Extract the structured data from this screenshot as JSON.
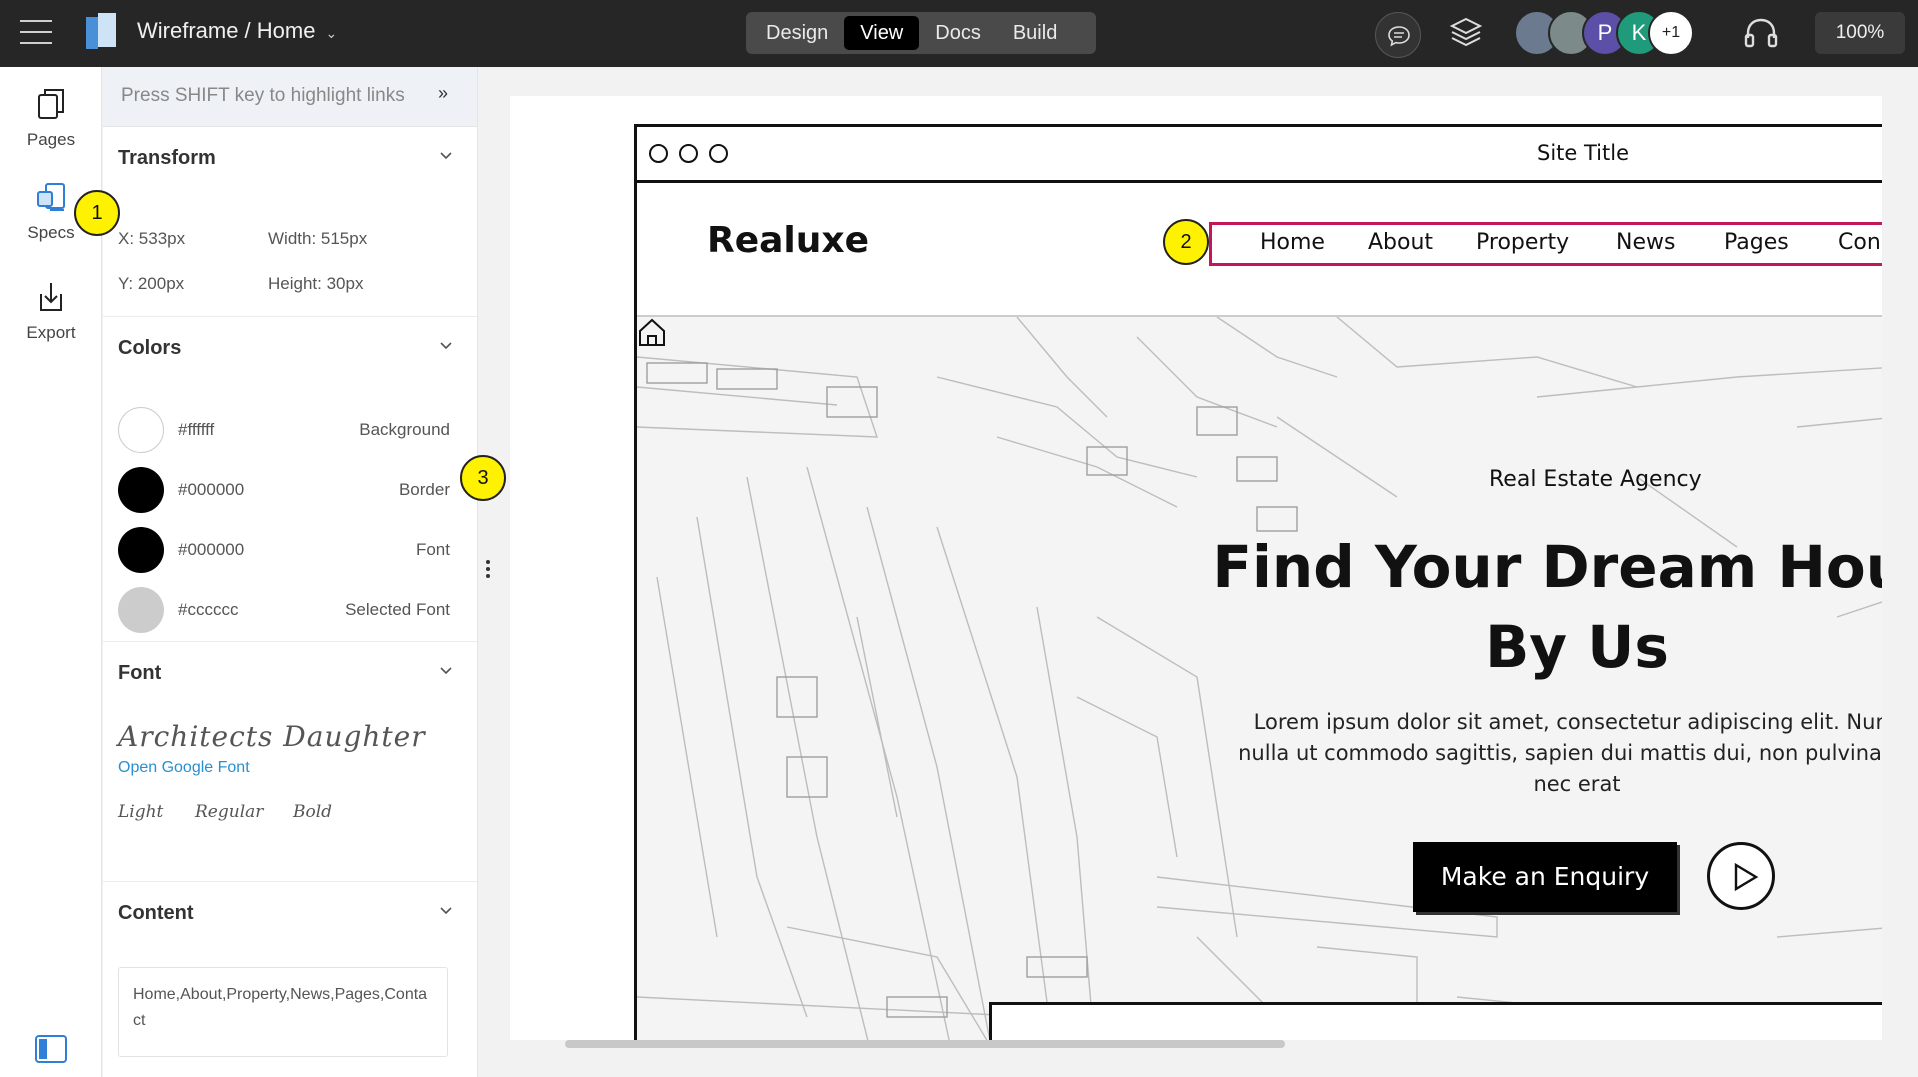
{
  "topbar": {
    "doc_title": "Wireframe / Home",
    "modes": [
      "Design",
      "View",
      "Docs",
      "Build"
    ],
    "active_mode": "View",
    "avatars": [
      {
        "initial": "",
        "color": "#6b7a8f"
      },
      {
        "initial": "",
        "color": "#7c8a8a"
      },
      {
        "initial": "P",
        "color": "#5b4fa8"
      },
      {
        "initial": "K",
        "color": "#1f9a7a"
      }
    ],
    "more_users": "+1",
    "zoom": "100%"
  },
  "rail": {
    "items": [
      "Pages",
      "Specs",
      "Export"
    ],
    "active": "Specs"
  },
  "panel": {
    "hint": "Press SHIFT key to highlight links",
    "transform": {
      "title": "Transform",
      "x": "X: 533px",
      "y": "Y: 200px",
      "width": "Width:  515px",
      "height": "Height: 30px"
    },
    "colors": {
      "title": "Colors",
      "items": [
        {
          "hex": "#ffffff",
          "role": "Background",
          "value": "#ffffff"
        },
        {
          "hex": "#000000",
          "role": "Border",
          "value": "#000000"
        },
        {
          "hex": "#000000",
          "role": "Font",
          "value": "#000000"
        },
        {
          "hex": "#cccccc",
          "role": "Selected Font",
          "value": "#cccccc"
        }
      ]
    },
    "font": {
      "title": "Font",
      "name": "Architects Daughter",
      "link": "Open Google Font",
      "weights": [
        "Light",
        "Regular",
        "Bold"
      ]
    },
    "content": {
      "title": "Content",
      "value": "Home,About,Property,News,Pages,Contact"
    }
  },
  "markers": [
    "1",
    "2",
    "3"
  ],
  "wireframe": {
    "site_title": "Site Title",
    "brand": "Realuxe",
    "nav": [
      "Home",
      "About",
      "Property",
      "News",
      "Pages",
      "Con"
    ],
    "tagline": "Real Estate Agency",
    "headline_1": "Find Your Dream Hous",
    "headline_2": "By Us",
    "lead_1": "Lorem ipsum dolor sit amet, consectetur adipiscing elit. Nunc",
    "lead_2": "nulla ut commodo sagittis, sapien dui mattis dui, non pulvinar lo",
    "lead_3": "nec erat",
    "cta": "Make an Enquiry"
  }
}
